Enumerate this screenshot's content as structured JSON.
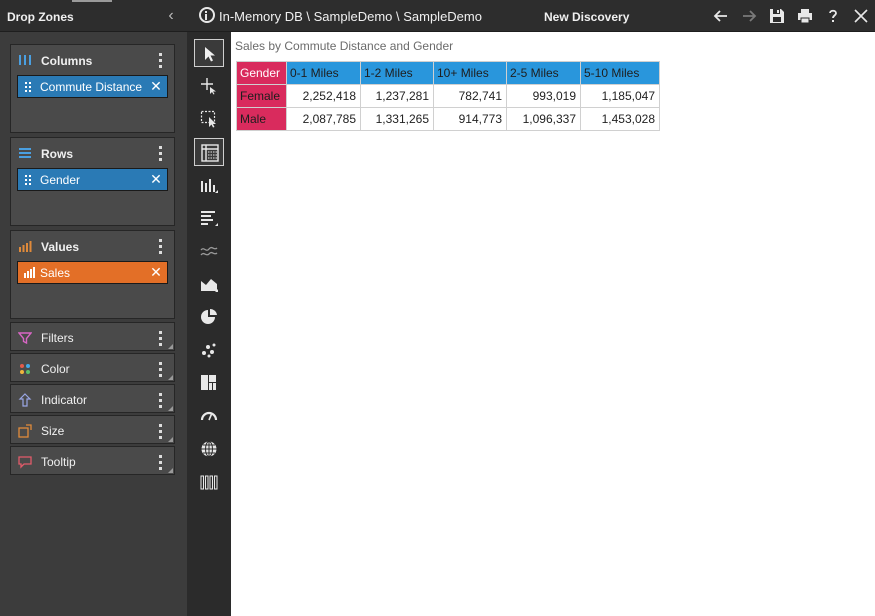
{
  "left_panel": {
    "title": "Drop Zones",
    "collapse_icon": "chevron-left-icon",
    "zones": {
      "columns": {
        "title": "Columns",
        "icon": "columns-icon",
        "fields": [
          {
            "label": "Commute Distance",
            "color": "#2a7ab5"
          }
        ]
      },
      "rows": {
        "title": "Rows",
        "icon": "rows-icon",
        "fields": [
          {
            "label": "Gender",
            "color": "#2a7ab5"
          }
        ]
      },
      "values": {
        "title": "Values",
        "icon": "bar-chart-icon",
        "fields": [
          {
            "label": "Sales",
            "color": "#e36f27"
          }
        ]
      },
      "filters": {
        "title": "Filters",
        "icon": "funnel-icon"
      },
      "color": {
        "title": "Color",
        "icon": "palette-icon"
      },
      "indicator": {
        "title": "Indicator",
        "icon": "arrow-up-icon"
      },
      "size": {
        "title": "Size",
        "icon": "size-icon"
      },
      "tooltip": {
        "title": "Tooltip",
        "icon": "tooltip-icon"
      }
    }
  },
  "header": {
    "breadcrumb": "In-Memory DB \\ SampleDemo \\ SampleDemo",
    "discovery_title": "New Discovery",
    "buttons": [
      "back-arrow-icon",
      "forward-arrow-icon",
      "save-icon",
      "print-icon",
      "help-icon",
      "close-icon"
    ]
  },
  "toolbar": {
    "tools": [
      "pointer-tool-icon",
      "move-tool-icon",
      "select-tool-icon",
      "pivot-table-icon",
      "column-chart-icon",
      "bar-chart-icon",
      "line-chart-icon",
      "area-chart-icon",
      "pie-chart-icon",
      "scatter-chart-icon",
      "treemap-icon",
      "gauge-icon",
      "map-icon",
      "more-visuals-icon"
    ],
    "active": "pivot-table-icon"
  },
  "canvas": {
    "viz_title": "Sales by Commute Distance and Gender",
    "pivot": {
      "corner_label": "Gender",
      "columns": [
        "0-1 Miles",
        "1-2 Miles",
        "10+ Miles",
        "2-5 Miles",
        "5-10 Miles"
      ],
      "rows": [
        {
          "label": "Female",
          "values": [
            "2,252,418",
            "1,237,281",
            "782,741",
            "993,019",
            "1,185,047"
          ]
        },
        {
          "label": "Male",
          "values": [
            "2,087,785",
            "1,331,265",
            "914,773",
            "1,096,337",
            "1,453,028"
          ]
        }
      ],
      "colors": {
        "corner": "#d92b5d",
        "column_header": "#2996dc",
        "row_header": "#d92b5d"
      }
    }
  }
}
